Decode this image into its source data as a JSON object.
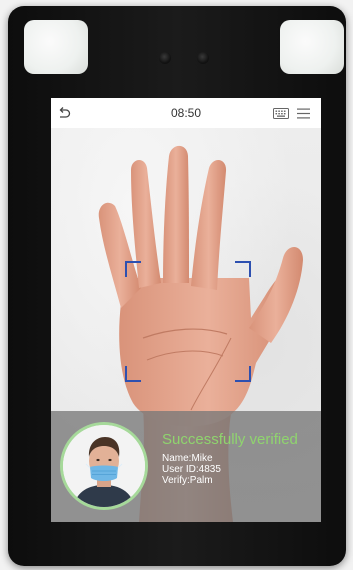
{
  "status_bar": {
    "time": "08:50",
    "back_icon": "back-arrow-icon",
    "keyboard_icon": "keyboard-icon",
    "menu_icon": "menu-icon"
  },
  "camera": {
    "subject": "palm",
    "frame_color": "#2d50b0"
  },
  "verification": {
    "status": "Successfully verified",
    "name_line": "Name:Mike",
    "user_id_line": "User ID:4835",
    "verify_line": "Verify:Palm",
    "status_color": "#8fd46e",
    "avatar_ring_color": "#a6d99a"
  }
}
